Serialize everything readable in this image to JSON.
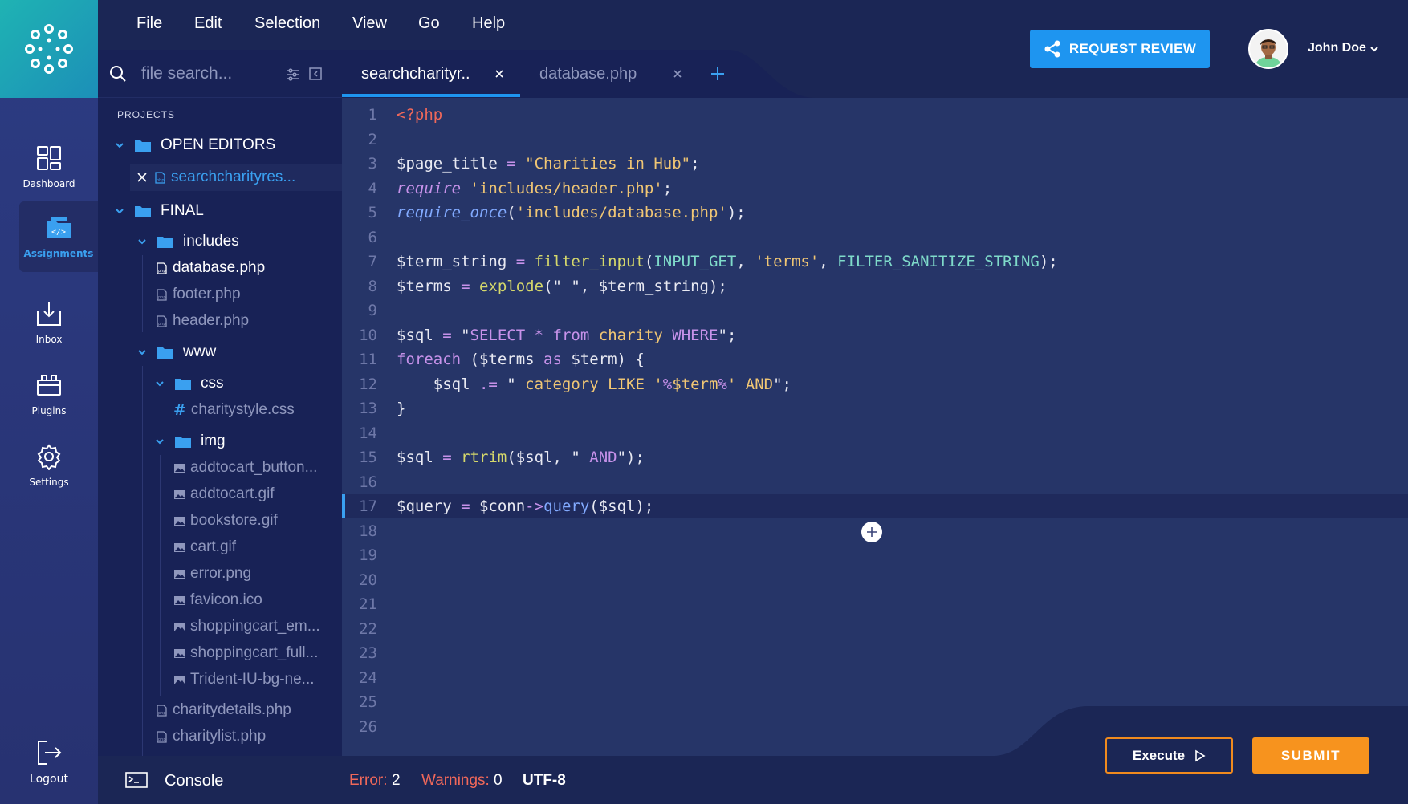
{
  "menu": [
    "File",
    "Edit",
    "Selection",
    "View",
    "Go",
    "Help"
  ],
  "header": {
    "review_label": "REQUEST REVIEW",
    "user_name": "John Doe"
  },
  "rail": {
    "items": [
      {
        "label": "Dashboard",
        "icon": "dashboard-icon"
      },
      {
        "label": "Assignments",
        "icon": "assignments-icon",
        "active": true
      },
      {
        "label": "Inbox",
        "icon": "inbox-icon"
      },
      {
        "label": "Plugins",
        "icon": "plugins-icon"
      },
      {
        "label": "Settings",
        "icon": "gear-icon"
      }
    ],
    "logout_label": "Logout"
  },
  "search": {
    "placeholder": "file search..."
  },
  "tree": {
    "section_label": "PROJECTS",
    "open_editors_label": "OPEN EDITORS",
    "open_editor_file": "searchcharityres...",
    "final_label": "FINAL",
    "includes_label": "includes",
    "includes_files": [
      "database.php",
      "footer.php",
      "header.php"
    ],
    "www_label": "www",
    "css_label": "css",
    "css_files": [
      "charitystyle.css"
    ],
    "img_label": "img",
    "img_files": [
      "addtocart_button...",
      "addtocart.gif",
      "bookstore.gif",
      "cart.gif",
      "error.png",
      "favicon.ico",
      "shoppingcart_em...",
      "shoppingcart_full...",
      "Trident-IU-bg-ne..."
    ],
    "root_files": [
      "charitydetails.php",
      "charitylist.php"
    ]
  },
  "tabs": [
    {
      "label": "searchcharityr..",
      "active": true
    },
    {
      "label": "database.php",
      "active": false
    }
  ],
  "code": {
    "line_numbers": [
      "1",
      "2",
      "3",
      "4",
      "5",
      "6",
      "7",
      "8",
      "9",
      "10",
      "11",
      "12",
      "13",
      "14",
      "15",
      "16",
      "17",
      "18",
      "19",
      "20",
      "21",
      "22",
      "23",
      "24",
      "25",
      "26"
    ],
    "active_line": 17,
    "lines": [
      [
        {
          "t": "<?php",
          "c": "tag"
        }
      ],
      [],
      [
        {
          "t": "$page_title "
        },
        {
          "t": "=",
          "c": "op"
        },
        {
          "t": " \"Charities in Hub\"",
          "c": "str"
        },
        {
          "t": ";"
        }
      ],
      [
        {
          "t": "require",
          "c": "kw it"
        },
        {
          "t": " 'includes/header.php'",
          "c": "str"
        },
        {
          "t": ";"
        }
      ],
      [
        {
          "t": "require_once",
          "c": "meth it"
        },
        {
          "t": "("
        },
        {
          "t": "'includes/database.php'",
          "c": "str"
        },
        {
          "t": ");"
        }
      ],
      [],
      [
        {
          "t": "$term_string "
        },
        {
          "t": "=",
          "c": "op"
        },
        {
          "t": " "
        },
        {
          "t": "filter_input",
          "c": "fn"
        },
        {
          "t": "("
        },
        {
          "t": "INPUT_GET",
          "c": "cst"
        },
        {
          "t": ", "
        },
        {
          "t": "'terms'",
          "c": "str"
        },
        {
          "t": ", "
        },
        {
          "t": "FILTER_SANITIZE_STRING",
          "c": "cst"
        },
        {
          "t": ");"
        }
      ],
      [
        {
          "t": "$terms "
        },
        {
          "t": "=",
          "c": "op"
        },
        {
          "t": " "
        },
        {
          "t": "explode",
          "c": "fn"
        },
        {
          "t": "(\" \", $term_string);"
        }
      ],
      [],
      [
        {
          "t": "$sql "
        },
        {
          "t": "=",
          "c": "op"
        },
        {
          "t": " \""
        },
        {
          "t": "SELECT",
          "c": "kw"
        },
        {
          "t": " "
        },
        {
          "t": "*",
          "c": "kw"
        },
        {
          "t": " "
        },
        {
          "t": "from",
          "c": "kw"
        },
        {
          "t": " "
        },
        {
          "t": "charity",
          "c": "str"
        },
        {
          "t": " "
        },
        {
          "t": "WHERE",
          "c": "kw"
        },
        {
          "t": "\";"
        }
      ],
      [
        {
          "t": "foreach",
          "c": "kw"
        },
        {
          "t": " ($terms "
        },
        {
          "t": "as",
          "c": "kw"
        },
        {
          "t": " $term) {"
        }
      ],
      [
        {
          "t": "    $sql "
        },
        {
          "t": ".=",
          "c": "op"
        },
        {
          "t": " \" "
        },
        {
          "t": "category LIKE '",
          "c": "str"
        },
        {
          "t": "%",
          "c": "kw"
        },
        {
          "t": "$term",
          "c": "str"
        },
        {
          "t": "%",
          "c": "kw"
        },
        {
          "t": "' AND",
          "c": "str"
        },
        {
          "t": "\";"
        }
      ],
      [
        {
          "t": "}"
        }
      ],
      [],
      [
        {
          "t": "$sql "
        },
        {
          "t": "=",
          "c": "op"
        },
        {
          "t": " "
        },
        {
          "t": "rtrim",
          "c": "fn"
        },
        {
          "t": "($sql, \" "
        },
        {
          "t": "AND",
          "c": "kw"
        },
        {
          "t": "\");"
        }
      ],
      [],
      [
        {
          "t": "$query "
        },
        {
          "t": "=",
          "c": "op"
        },
        {
          "t": " $conn"
        },
        {
          "t": "->",
          "c": "op"
        },
        {
          "t": "query",
          "c": "meth"
        },
        {
          "t": "($sql);"
        }
      ],
      [],
      [],
      [],
      [],
      [],
      [],
      [],
      [],
      []
    ]
  },
  "bottom": {
    "console_label": "Console",
    "error_label": "Error:",
    "error_count": "2",
    "warnings_label": "Warnings:",
    "warnings_count": "0",
    "encoding": "UTF-8"
  },
  "actions": {
    "execute_label": "Execute",
    "submit_label": "SUBMIT"
  },
  "colors": {
    "accent": "#1e95f0",
    "submit": "#f7931e",
    "error": "#f0685a"
  }
}
